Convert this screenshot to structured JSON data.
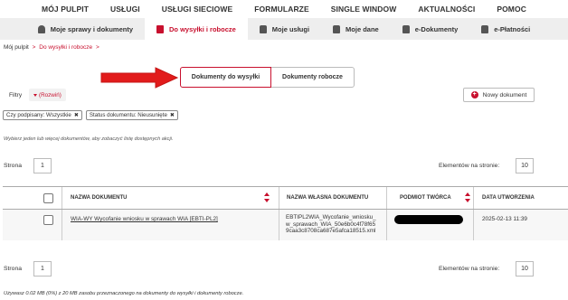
{
  "top_nav": [
    "MÓJ PULPIT",
    "USŁUGI",
    "USŁUGI SIECIOWE",
    "FORMULARZE",
    "SINGLE WINDOW",
    "AKTUALNOŚCI",
    "POMOC"
  ],
  "sub_nav": [
    {
      "label": "Moje sprawy i dokumenty",
      "icon": "person-icon",
      "active": false
    },
    {
      "label": "Do wysyłki i robocze",
      "icon": "document-icon",
      "active": true
    },
    {
      "label": "Moje usługi",
      "icon": "lock-icon",
      "active": false
    },
    {
      "label": "Moje dane",
      "icon": "lock-icon",
      "active": false
    },
    {
      "label": "e-Dokumenty",
      "icon": "lock-icon",
      "active": false
    },
    {
      "label": "e-Płatności",
      "icon": "lock-icon",
      "active": false
    }
  ],
  "breadcrumb": {
    "root": "Mój pulpit",
    "separator": ">",
    "current": "Do wysyłki i robocze",
    "trail_sep": ">"
  },
  "tabs": {
    "active": "Dokumenty do wysyłki",
    "inactive": "Dokumenty robocze"
  },
  "filters": {
    "label": "Filtry",
    "toggle": "(Rozwiń)"
  },
  "new_document_button": "Nowy dokument",
  "chips": [
    {
      "label": "Czy podpisany: Wszystkie",
      "remove": "✖"
    },
    {
      "label": "Status dokumentu: Nieusunięte",
      "remove": "✖"
    }
  ],
  "hint": "Wybierz jeden lub więcej dokumentów, aby zobaczyć listę dostępnych akcji.",
  "pager": {
    "page_label": "Strona",
    "page": "1",
    "per_page_label": "Elementów na stronie:",
    "per_page": "10"
  },
  "table": {
    "headers": [
      "NAZWA DOKUMENTU",
      "NAZWA WŁASNA DOKUMENTU",
      "PODMIOT TWÓRCA",
      "DATA UTWORZENIA"
    ],
    "rows": [
      {
        "name": "WIA-WY Wycofanie wniosku w sprawach WIA [EBTI-PL2]",
        "own_name": "EBTIPL2WIA_Wycofanie_wniosku_w_sprawach_WIA_50e6b0c4f78f659caa3c8708ca687e5afca18515.xml",
        "date": "2025-02-13 11:39"
      }
    ]
  },
  "usage": "Używasz 0.02 MB (0%) z 20 MB zasobu przeznaczonego na dokumenty do wysyłki i dokumenty robocze.",
  "colors": {
    "accent": "#c8102e",
    "subnav_bg": "#eeeeee",
    "arrow": "#e21b1b"
  }
}
